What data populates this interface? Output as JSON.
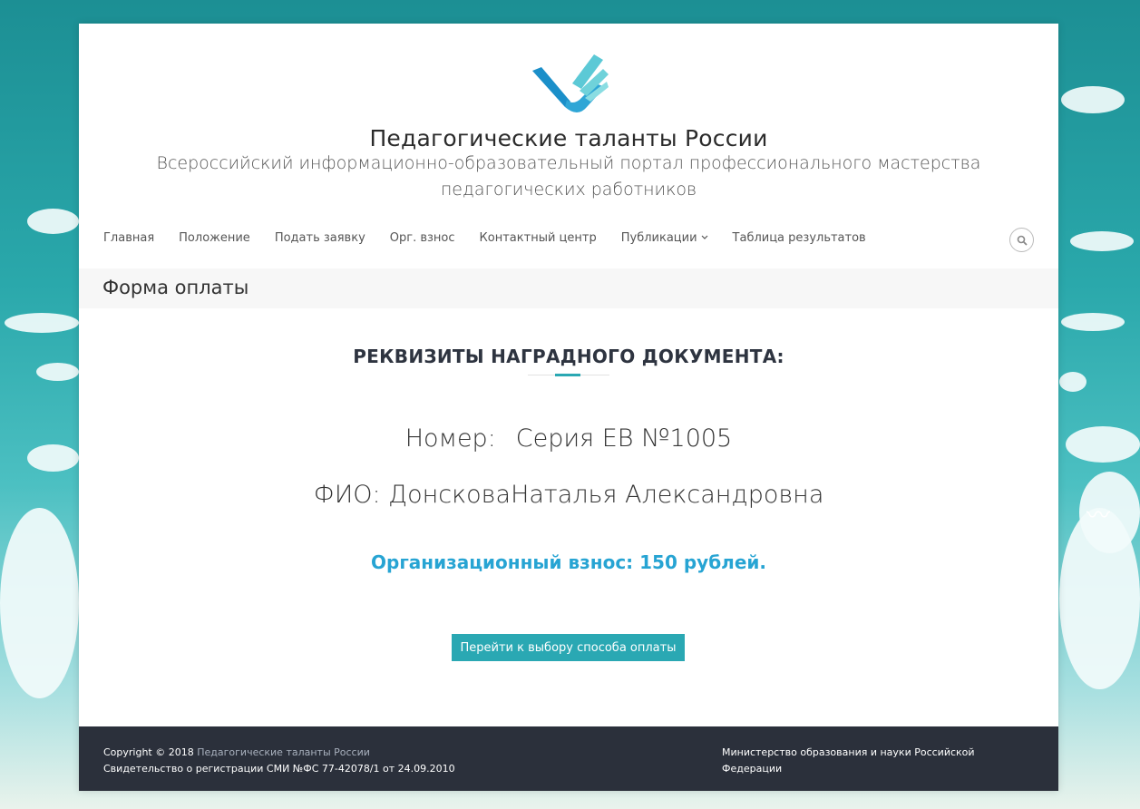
{
  "site": {
    "title": "Педагогические таланты России",
    "tagline": "Всероссийский информационно-образовательный портал профессионального мастерства педагогических работников"
  },
  "nav": {
    "items": [
      {
        "label": "Главная"
      },
      {
        "label": "Положение"
      },
      {
        "label": "Подать заявку"
      },
      {
        "label": "Орг. взнос"
      },
      {
        "label": "Контактный центр"
      },
      {
        "label": "Публикации",
        "has_dropdown": true
      },
      {
        "label": "Таблица результатов"
      }
    ],
    "search_icon": "search-icon"
  },
  "page": {
    "title": "Форма оплаты"
  },
  "document": {
    "heading": "РЕКВИЗИТЫ НАГРАДНОГО ДОКУМЕНТА:",
    "number_label": "Номер:",
    "number_value": "Серия ЕВ №1005",
    "fio_label": "ФИО:",
    "fio_surname": "Донскова",
    "fio_name": "Наталья Александровна",
    "fee_text": "Организационный взнос: 150 рублей.",
    "pay_button": "Перейти к выбору способа оплаты"
  },
  "footer": {
    "copyright_prefix": "Copyright © 2018",
    "copyright_link": "Педагогические таланты России",
    "registration": "Свидетельство о регистрации СМИ №ФС 77-42078/1 от 24.09.2010",
    "ministry": "Министерство образования и науки Российской Федерации"
  },
  "colors": {
    "accent": "#2aa8b3",
    "fee": "#27a4d3",
    "footer_bg": "#2b303b"
  }
}
